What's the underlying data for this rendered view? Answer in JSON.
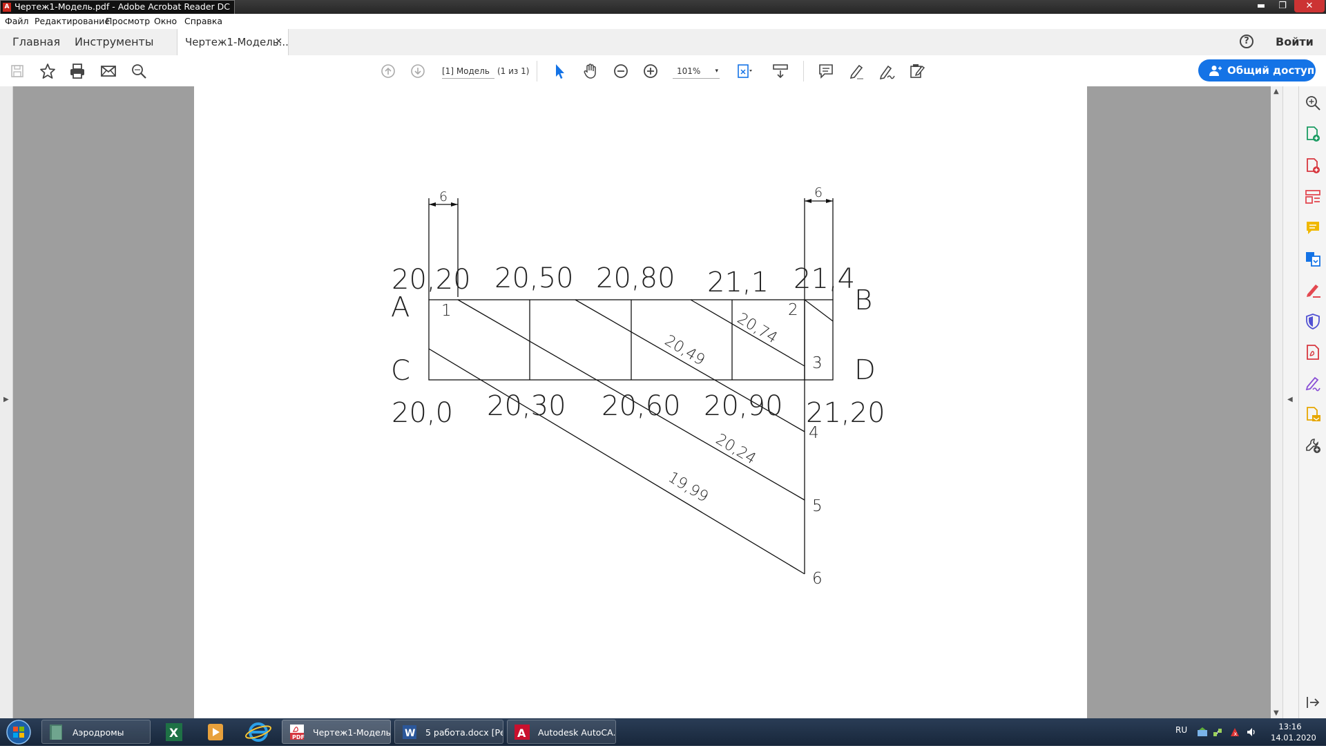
{
  "window": {
    "title": "Чертеж1-Модель.pdf - Adobe Acrobat Reader DC",
    "minimize": "▬",
    "maximize": "❐",
    "close": "✕"
  },
  "menu": [
    "Файл",
    "Редактирование",
    "Просмотр",
    "Окно",
    "Справка"
  ],
  "tabs": {
    "home": "Главная",
    "tools": "Инструменты",
    "document": "Чертеж1-Модель...",
    "close": "✕",
    "help": "?",
    "signin": "Войти"
  },
  "toolbar": {
    "page_label": "[1] Модель",
    "page_count": "(1 из 1)",
    "zoom": "101%",
    "zoom_arrow": "▾",
    "share": "Общий доступ"
  },
  "drawing": {
    "dimension_left": "6",
    "dimension_right": "6",
    "top_elevations": [
      "20,20",
      "20,50",
      "20,80",
      "21,1",
      "21,4"
    ],
    "bottom_elevations": [
      "20,0",
      "20,30",
      "20,60",
      "20,90",
      "21,20"
    ],
    "corners": {
      "a": "A",
      "b": "B",
      "c": "C",
      "d": "D"
    },
    "points": [
      "1",
      "2",
      "3",
      "4",
      "5",
      "6"
    ],
    "line_values": [
      "20,74",
      "20,49",
      "20,24",
      "19,99"
    ]
  },
  "taskbar": {
    "apps": [
      "Аэродромы",
      "Чертеж1-Модель...",
      "5 работа.docx [Ре...",
      "Autodesk AutoCA..."
    ],
    "language": "RU",
    "time": "13:16",
    "date": "14.01.2020"
  },
  "colors": {
    "accent": "#1473e6",
    "titlebar": "#262626",
    "doc_background": "#9e9e9e",
    "taskbar": "#17263a"
  }
}
